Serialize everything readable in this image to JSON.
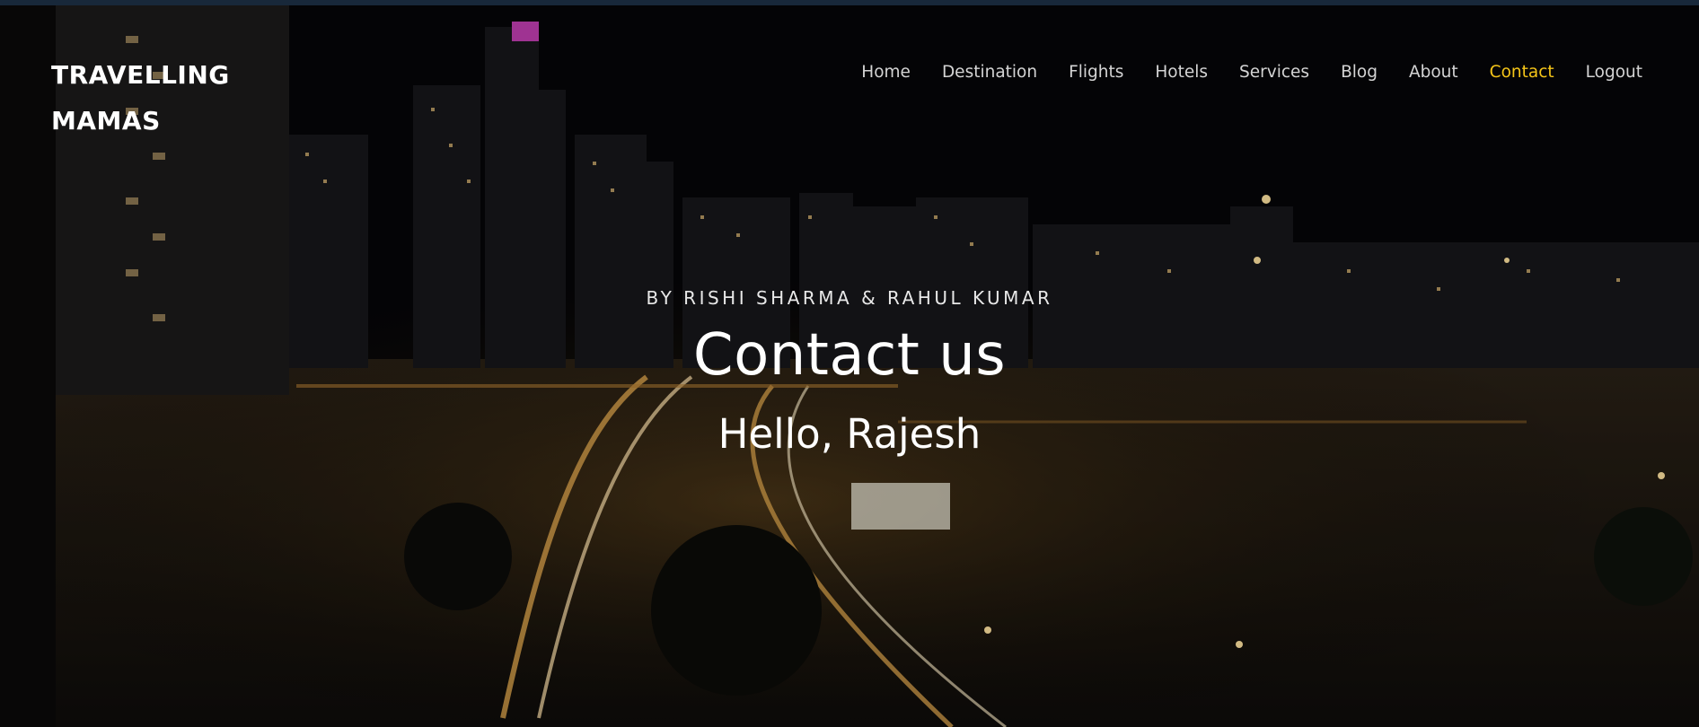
{
  "brand": {
    "line1": "TRAVELLING",
    "line2": "MAMAS"
  },
  "nav": {
    "items": [
      {
        "label": "Home",
        "active": false
      },
      {
        "label": "Destination",
        "active": false
      },
      {
        "label": "Flights",
        "active": false
      },
      {
        "label": "Hotels",
        "active": false
      },
      {
        "label": "Services",
        "active": false
      },
      {
        "label": "Blog",
        "active": false
      },
      {
        "label": "About",
        "active": false
      },
      {
        "label": "Contact",
        "active": true
      },
      {
        "label": "Logout",
        "active": false
      }
    ]
  },
  "hero": {
    "byline": "BY RISHI SHARMA & RAHUL KUMAR",
    "title": "Contact us",
    "greeting": "Hello, Rajesh",
    "background": "night city skyline with highway light trails"
  },
  "colors": {
    "accent": "#f5c518",
    "nav_text": "#d4d4d4",
    "hero_text": "#ffffff"
  }
}
